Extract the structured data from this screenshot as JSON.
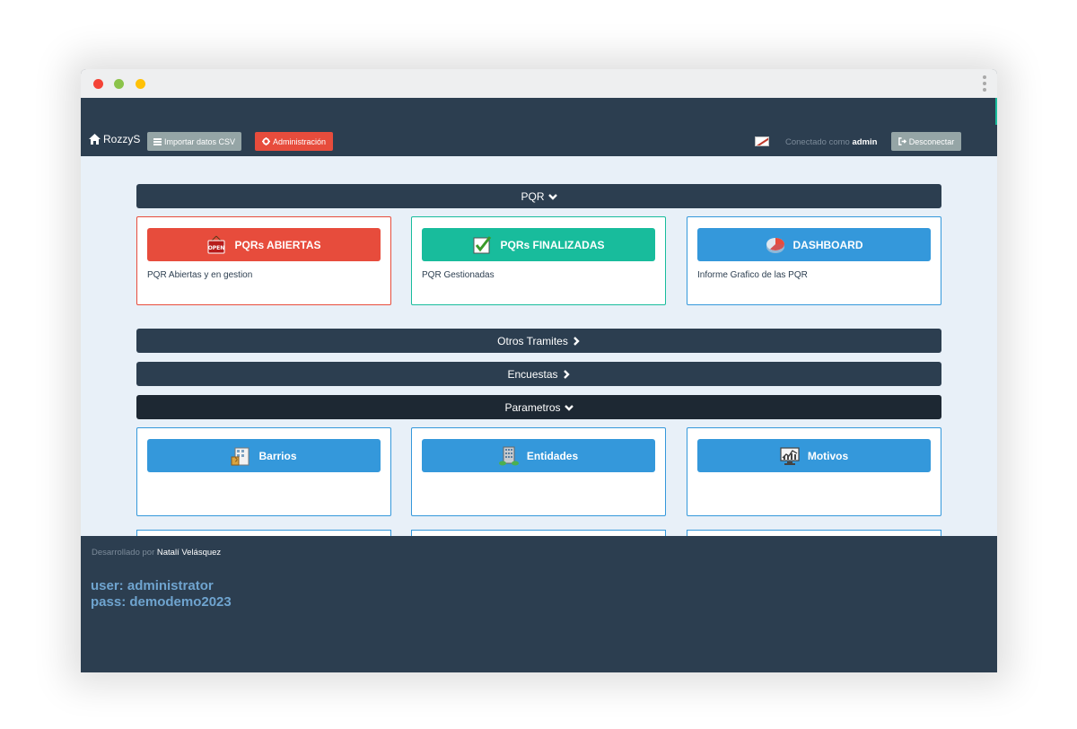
{
  "app": {
    "brand": "RozzyS"
  },
  "navbar": {
    "import_label": "Importar datos CSV",
    "admin_label": "Administración",
    "connected_prefix": "Conectado como",
    "connected_user": "admin",
    "logout_label": "Desconectar"
  },
  "sections": {
    "pqr": "PQR",
    "otros": "Otros Tramites",
    "encuestas": "Encuestas",
    "parametros": "Parametros"
  },
  "pqr_cards": [
    {
      "label": "PQRs ABIERTAS",
      "desc": "PQR Abiertas y en gestion",
      "icon": "open-sign-icon",
      "color": "#e74c3c"
    },
    {
      "label": "PQRs FINALIZADAS",
      "desc": "PQR Gestionadas",
      "icon": "checkbox-icon",
      "color": "#18bc9c"
    },
    {
      "label": "DASHBOARD",
      "desc": "Informe Grafico de las PQR",
      "icon": "pie-chart-icon",
      "color": "#3498db"
    }
  ],
  "param_cards": [
    {
      "label": "Barrios",
      "icon": "building-icon"
    },
    {
      "label": "Entidades",
      "icon": "office-tower-icon"
    },
    {
      "label": "Motivos",
      "icon": "chart-monitor-icon"
    }
  ],
  "footer": {
    "credit_prefix": "Desarrollado por",
    "credit_name": "Natalí Velásquez",
    "user_line": "user: administrator",
    "pass_line": "pass: demodemo2023"
  }
}
